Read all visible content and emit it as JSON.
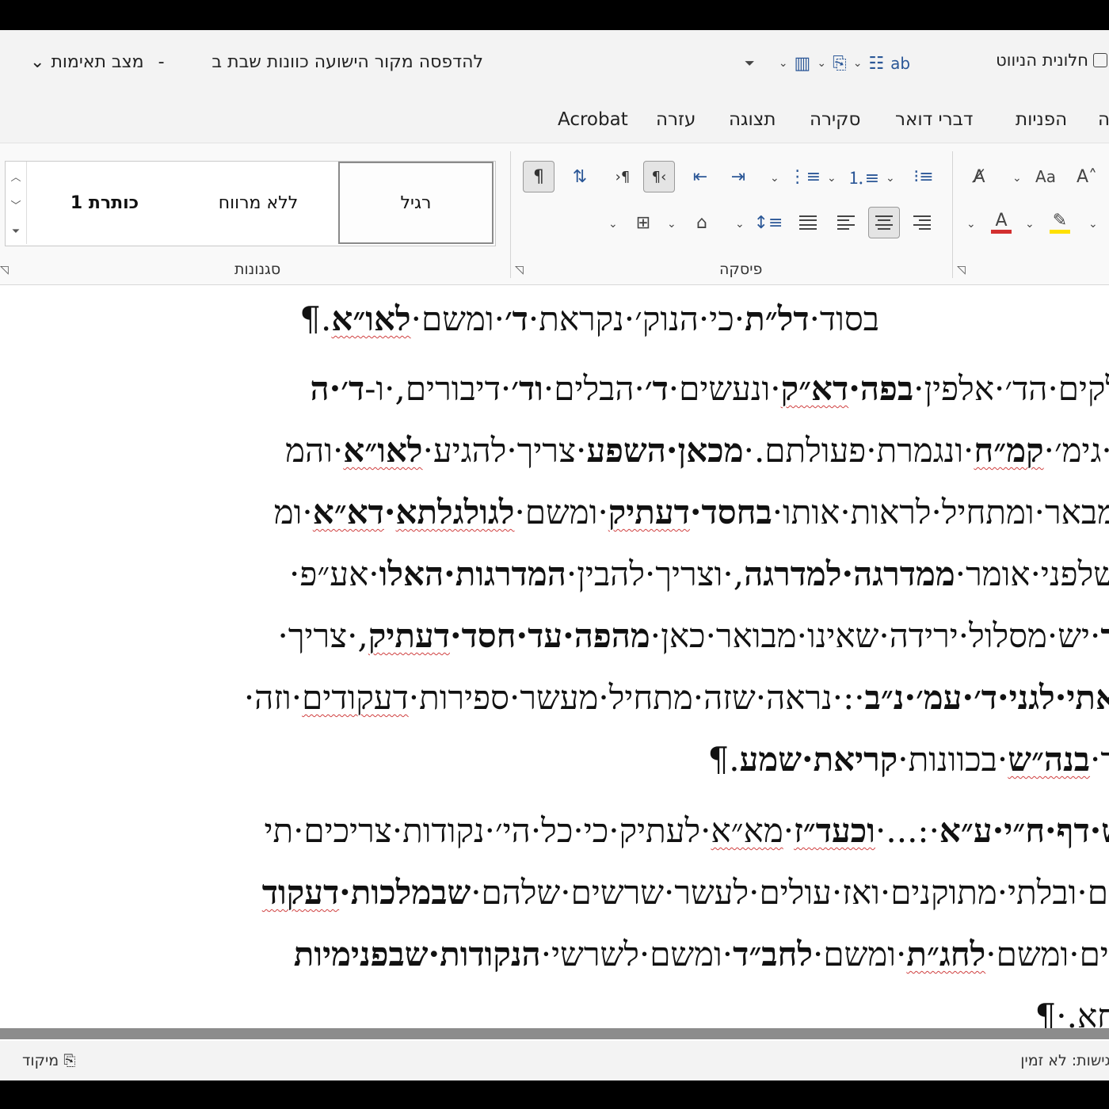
{
  "window": {
    "doc_title": "להדפסה מקור הישועה כוונות שבת ב",
    "separator": "-",
    "compat_mode": "מצב תאימות",
    "nav_pane_label": "חלונית הניווט"
  },
  "tabs": [
    "Acrobat",
    "עזרה",
    "תצוגה",
    "סקירה",
    "דברי דואר",
    "הפניות",
    "ה"
  ],
  "ribbon": {
    "styles_group": "סגנונות",
    "paragraph_group": "פיסקה",
    "styles": [
      "רגיל",
      "ללא מרווח",
      "כותרת 1"
    ]
  },
  "document": {
    "lines": [
      "בסוד·<b>דל״ת</b>·כי·הנוק׳·נקראת·<b>ד׳</b>·ומשם·<b><u>לאו״א</u></b>.¶",
      "<span>חלקים·הד׳·אלפין·<b>בפה·<u>דא״ק</u></b>·ונעשים·<b>ד׳</b>·הבלים·<b>וד׳</b>·דיבורים,·ו-<b>ד׳·ה</b></span>",
      "ם·גימ׳·<b><u>קמ״ח</u></b>·ונגמרת·פעולתם.·<b>מכאן·השפע</b>·צריך·להגיע·<b><u>לאו״א</u></b>·והמ",
      "מבאר·ומתחיל·לראות·אותו·<b>בחסד·<u>דעתיק</u></b>·ומשם·<b><u>לגולגלתא</u>·<u>דא״א</u></b>·ומ",
      "שלפני·אומר·<b>ממדרגה·למדרגה</b>,·וצריך·להבין·<b>המדרגות·האלו</b>·אע״פ·",
      "<b>ך</b>·יש·מסלול·ירידה·שאינו·מבואר·כאן·<b>מהפה·עד·חסד·<u>דעתיק</u></b>,·צריך·",
      "<b>אתי·לגני·ד׳·עמ׳·נ״ב</b>·:·נראה·שזה·מתחיל·מעשר·ספירות·<u>דעקודים</u>·וזה·",
      "ר·<b><u>בנה״ש</u></b>·בכוונות·<b>קריאת·שמע</b>.¶",
      "<b>ש·דף·ח״י·ע״א</b>·:...·<b><u>וכעד״ז</u></b>·<u>מא״א</u>·לעתיק·כי·כל·הי׳·נקודות·צריכים·תי",
      "ים·ובלתי·מתוקנים·ואז·עולים·לעשר·שרשים·שלהם·<b>שבמלכות·<u>דעקוד</u></b>",
      "דים·ומשם·<b><u>לחג״ת</u></b>·ומשם·<b>לחב״ד</b>·ומשם·לשרשי·<b>הנקודות·שבפנימיות</b>",
      "חא.·¶"
    ]
  },
  "status": {
    "focus_label": "מיקוד",
    "accessibility": "נגישות: לא זמין"
  },
  "colors": {
    "accent": "#2b5797",
    "font_color_bar": "#d32f2f",
    "highlight_bar": "#ffe100",
    "spell_underline": "#d04040"
  }
}
